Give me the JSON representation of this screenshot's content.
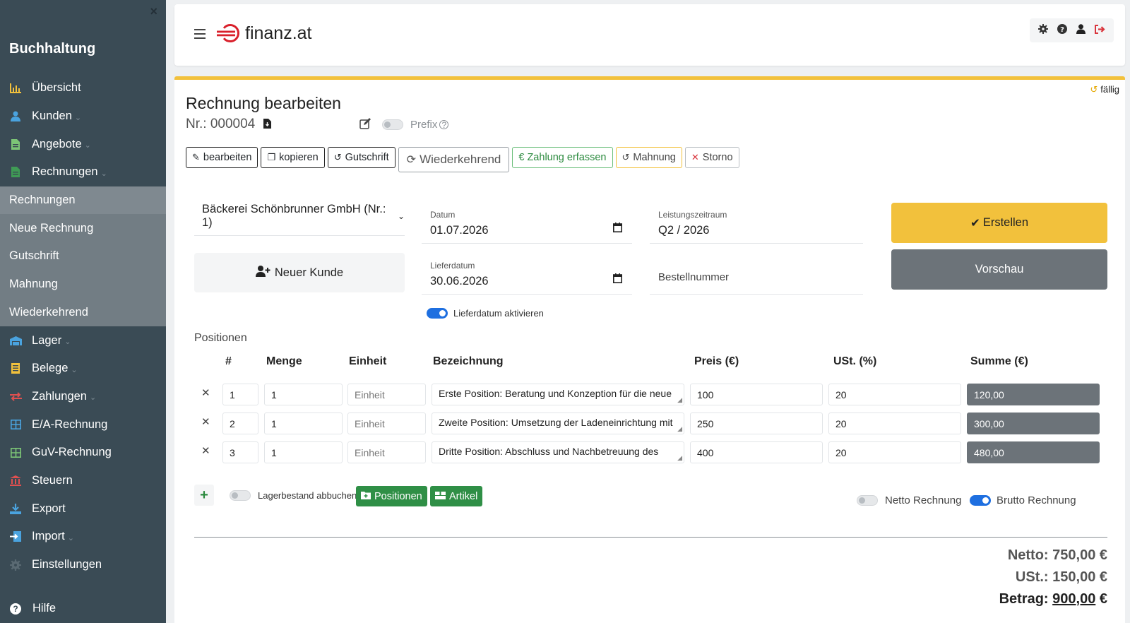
{
  "sidebar": {
    "brand": "Buchhaltung",
    "close": "×",
    "items": [
      {
        "label": "Übersicht",
        "icon": "chart-bar-icon",
        "glyph": "▟",
        "color": "#f2c13c",
        "chevron": false
      },
      {
        "label": "Kunden",
        "icon": "user-icon",
        "glyph": "●",
        "color": "#4aa3df",
        "chevron": true
      },
      {
        "label": "Angebote",
        "icon": "document-icon",
        "glyph": "▤",
        "color": "#7cc576",
        "chevron": true
      },
      {
        "label": "Rechnungen",
        "icon": "invoice-icon",
        "glyph": "▤",
        "color": "#3f9b55",
        "chevron": true
      }
    ],
    "subitems": [
      "Rechnungen",
      "Neue Rechnung",
      "Gutschrift",
      "Mahnung",
      "Wiederkehrend"
    ],
    "items2": [
      {
        "label": "Lager",
        "icon": "warehouse-icon",
        "glyph": "▬",
        "color": "#4aa3df",
        "chevron": true
      },
      {
        "label": "Belege",
        "icon": "receipt-icon",
        "glyph": "▤",
        "color": "#f2c13c",
        "chevron": true
      },
      {
        "label": "Zahlungen",
        "icon": "exchange-icon",
        "glyph": "⇄",
        "color": "#e05050",
        "chevron": true
      },
      {
        "label": "E/A-Rechnung",
        "icon": "table-icon",
        "glyph": "▦",
        "color": "#4aa3df",
        "chevron": false
      },
      {
        "label": "GuV-Rechnung",
        "icon": "table-green-icon",
        "glyph": "▦",
        "color": "#7cc576",
        "chevron": false
      },
      {
        "label": "Steuern",
        "icon": "bank-icon",
        "glyph": "⌂",
        "color": "#e05050",
        "chevron": false
      },
      {
        "label": "Export",
        "icon": "download-icon",
        "glyph": "⤓",
        "color": "#4aa3df",
        "chevron": false
      },
      {
        "label": "Import",
        "icon": "import-icon",
        "glyph": "⇥",
        "color": "#4aa3df",
        "chevron": true
      },
      {
        "label": "Einstellungen",
        "icon": "gear-icon",
        "glyph": "✹",
        "color": "#5a6a73",
        "chevron": false
      }
    ],
    "help": "Hilfe"
  },
  "header": {
    "logo": "finanz.at"
  },
  "invoice": {
    "status": "fällig",
    "title": "Rechnung bearbeiten",
    "number": "Nr.: 000004",
    "prefix_label": "Prefix",
    "toolbar": {
      "edit": "bearbeiten",
      "copy": "kopieren",
      "credit": "Gutschrift",
      "recurring": "Wiederkehrend",
      "payment": "€ Zahlung erfassen",
      "reminder": "Mahnung",
      "cancel": "Storno"
    },
    "customer": "Bäckerei Schönbrunner GmbH (Nr.: 1)",
    "new_customer": "Neuer Kunde",
    "date_label": "Datum",
    "date": "01.07.2026",
    "delivery_label": "Lieferdatum",
    "delivery_date": "30.06.2026",
    "period_label": "Leistungszeitraum",
    "period": "Q2 / 2026",
    "order_placeholder": "Bestellnummer",
    "delivery_toggle": "Lieferdatum aktivieren",
    "create": "Erstellen",
    "preview": "Vorschau",
    "positions_title": "Positionen",
    "columns": [
      "#",
      "Menge",
      "Einheit",
      "Bezeichnung",
      "Preis (€)",
      "USt. (%)",
      "Summe (€)"
    ],
    "rows": [
      {
        "nr": "1",
        "qty": "1",
        "unit": "Einheit",
        "desc": "Erste Position: Beratung und Konzeption für die neue",
        "price": "100",
        "vat": "20",
        "sum": "120,00"
      },
      {
        "nr": "2",
        "qty": "1",
        "unit": "Einheit",
        "desc": "Zweite Position: Umsetzung der Ladeneinrichtung mit",
        "price": "250",
        "vat": "20",
        "sum": "300,00"
      },
      {
        "nr": "3",
        "qty": "1",
        "unit": "Einheit",
        "desc": "Dritte Position: Abschluss und Nachbetreuung des",
        "price": "400",
        "vat": "20",
        "sum": "480,00"
      }
    ],
    "stock_label": "Lagerbestand abbuchen",
    "positions_btn": "Positionen",
    "articles_btn": "Artikel",
    "netto_label": "Netto Rechnung",
    "brutto_label": "Brutto Rechnung",
    "netto_total": "Netto: 750,00 €",
    "vat_total": "USt.: 150,00 €",
    "grand_label": "Betrag: ",
    "grand_amount": "900,00",
    "grand_currency": " €"
  }
}
